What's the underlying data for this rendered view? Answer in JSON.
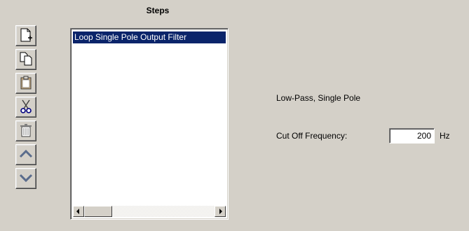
{
  "steps_panel": {
    "title": "Steps",
    "items": [
      {
        "label": "Loop Single Pole Output Filter",
        "selected": true
      }
    ]
  },
  "toolbar": {
    "buttons": [
      {
        "name": "new-step-button",
        "icon": "new-document-icon"
      },
      {
        "name": "copy-step-button",
        "icon": "copy-icon"
      },
      {
        "name": "paste-step-button",
        "icon": "clipboard-icon"
      },
      {
        "name": "cut-step-button",
        "icon": "scissors-icon"
      },
      {
        "name": "delete-step-button",
        "icon": "trash-icon"
      },
      {
        "name": "move-up-button",
        "icon": "chevron-up-icon"
      },
      {
        "name": "move-down-button",
        "icon": "chevron-down-icon"
      }
    ]
  },
  "filter": {
    "type_label": "Low-Pass, Single Pole",
    "cutoff_label": "Cut Off Frequency:",
    "cutoff_value": "200",
    "cutoff_unit": "Hz"
  },
  "colors": {
    "background": "#d4d0c8",
    "selection": "#0a246a",
    "selection_text": "#ffffff"
  }
}
